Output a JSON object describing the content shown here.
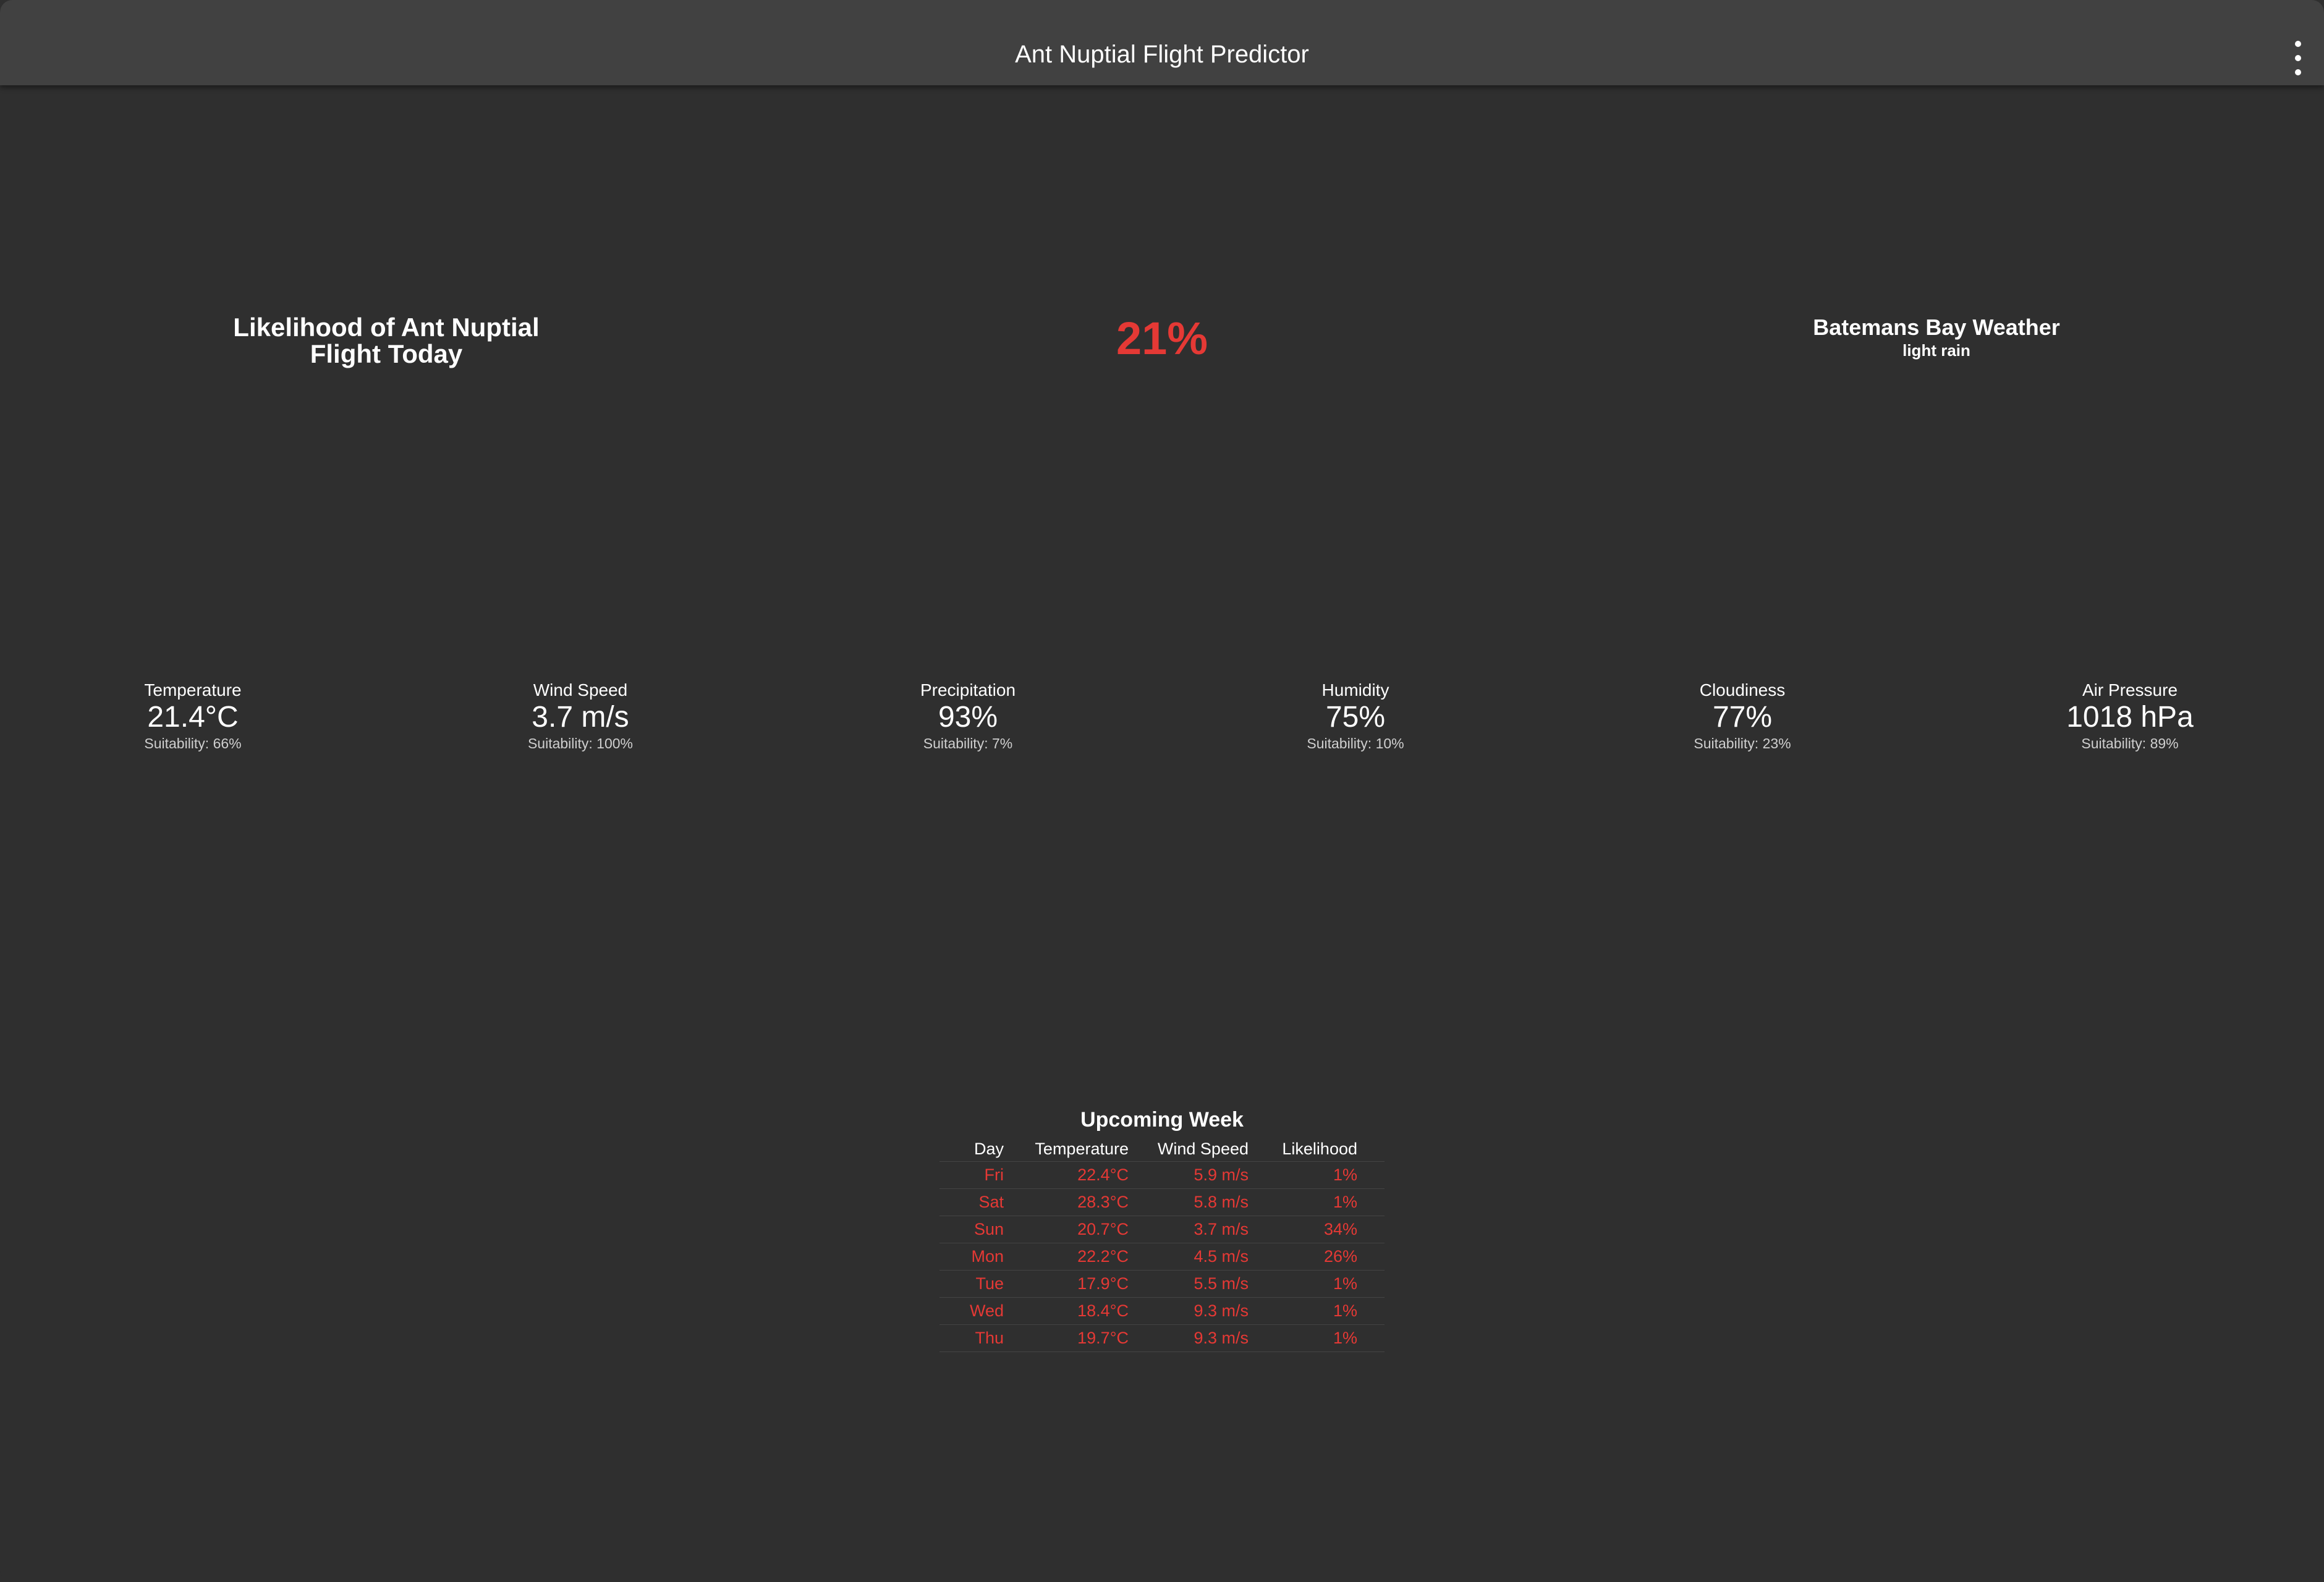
{
  "app": {
    "title": "Ant Nuptial Flight Predictor",
    "menu_icon": "more-vert-icon"
  },
  "today": {
    "likelihood_label": "Likelihood of Ant Nuptial Flight Today",
    "likelihood_value": "21%"
  },
  "weather": {
    "location": "Batemans Bay Weather",
    "description": "light rain"
  },
  "metrics": [
    {
      "label": "Temperature",
      "value": "21.4°C",
      "suitability": "Suitability: 66%"
    },
    {
      "label": "Wind Speed",
      "value": "3.7 m/s",
      "suitability": "Suitability: 100%"
    },
    {
      "label": "Precipitation",
      "value": "93%",
      "suitability": "Suitability: 7%"
    },
    {
      "label": "Humidity",
      "value": "75%",
      "suitability": "Suitability: 10%"
    },
    {
      "label": "Cloudiness",
      "value": "77%",
      "suitability": "Suitability: 23%"
    },
    {
      "label": "Air Pressure",
      "value": "1018 hPa",
      "suitability": "Suitability: 89%"
    }
  ],
  "week": {
    "title": "Upcoming Week",
    "headers": [
      "Day",
      "Temperature",
      "Wind Speed",
      "Likelihood"
    ],
    "rows": [
      [
        "Fri",
        "22.4°C",
        "5.9 m/s",
        "1%"
      ],
      [
        "Sat",
        "28.3°C",
        "5.8 m/s",
        "1%"
      ],
      [
        "Sun",
        "20.7°C",
        "3.7 m/s",
        "34%"
      ],
      [
        "Mon",
        "22.2°C",
        "4.5 m/s",
        "26%"
      ],
      [
        "Tue",
        "17.9°C",
        "5.5 m/s",
        "1%"
      ],
      [
        "Wed",
        "18.4°C",
        "9.3 m/s",
        "1%"
      ],
      [
        "Thu",
        "19.7°C",
        "9.3 m/s",
        "1%"
      ]
    ]
  },
  "colors": {
    "background": "#2f2f2f",
    "appbar": "#414141",
    "accent_red": "#e53935",
    "text": "#ffffff"
  }
}
